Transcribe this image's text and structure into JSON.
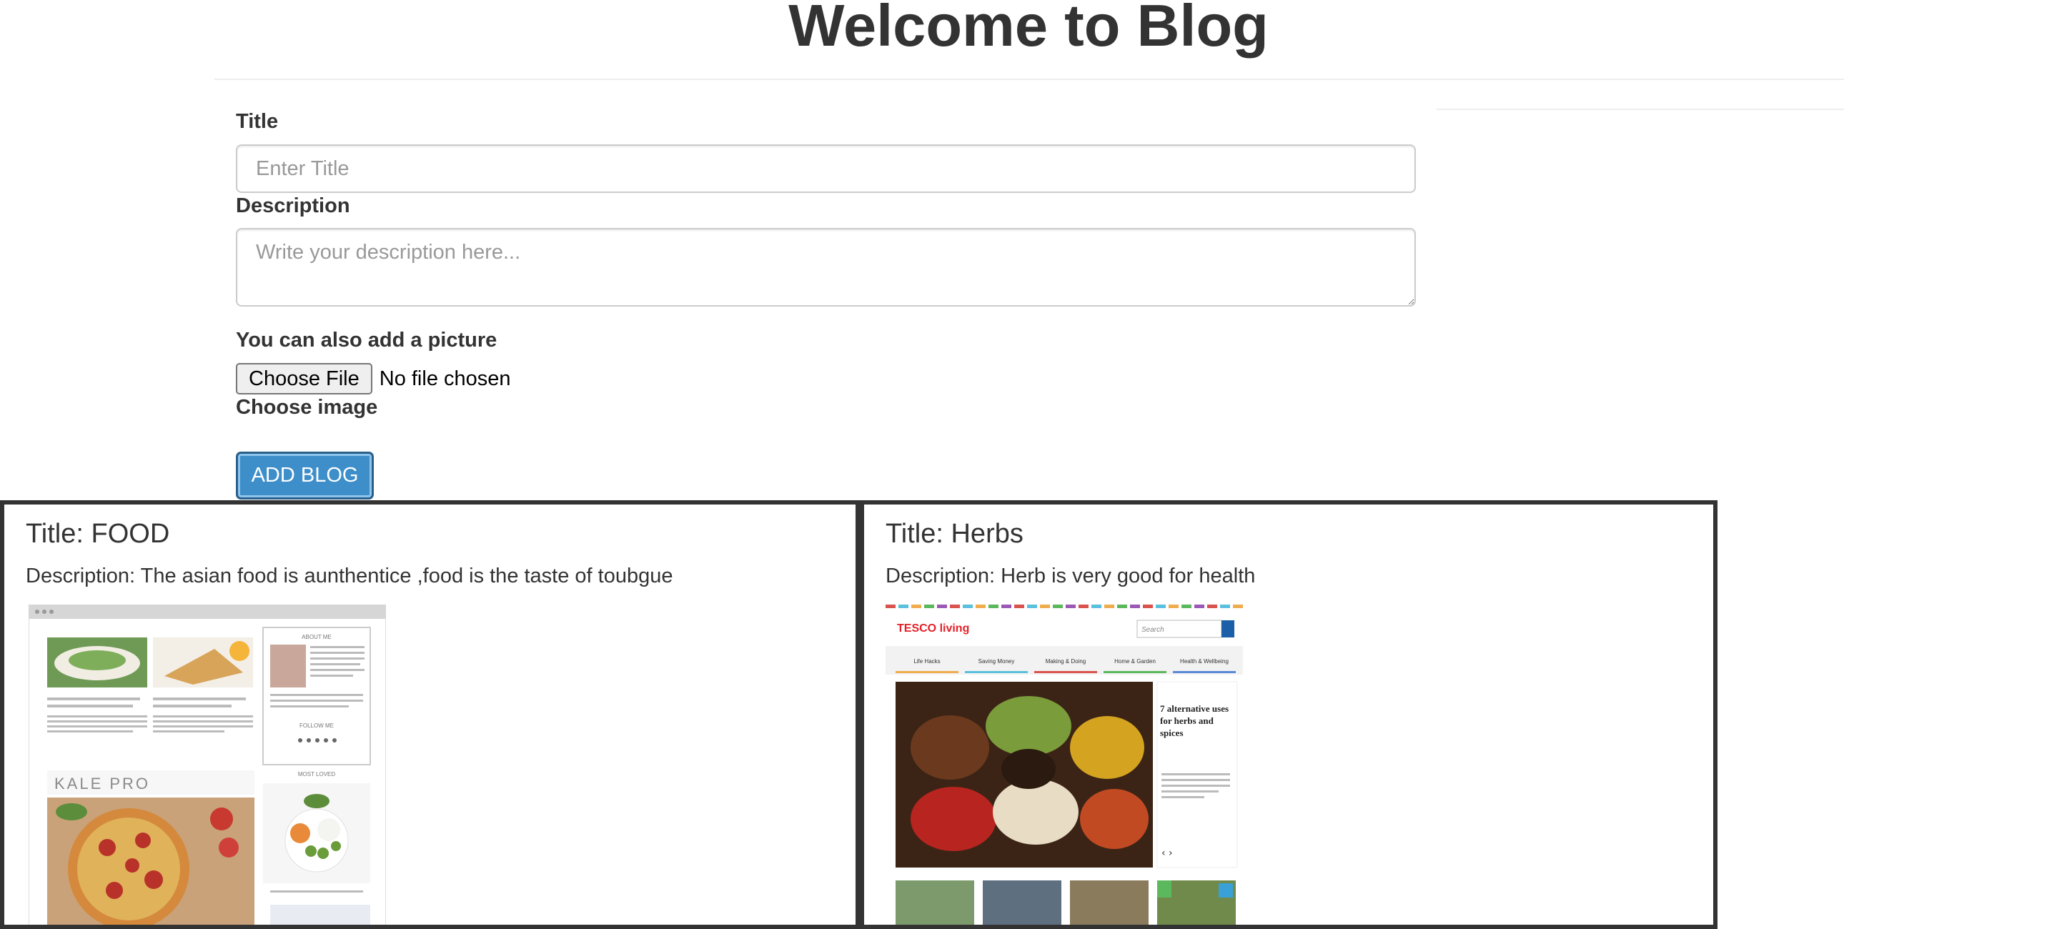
{
  "header": {
    "title": "Welcome to Blog"
  },
  "form": {
    "title_label": "Title",
    "title_placeholder": "Enter Title",
    "description_label": "Description",
    "description_placeholder": "Write your description here...",
    "picture_label": "You can also add a picture",
    "file_button": "Choose File",
    "file_status": "No file chosen",
    "choose_image_label": "Choose image",
    "submit_label": "ADD BLOG"
  },
  "posts": [
    {
      "title": "Title: FOOD",
      "description": "Description: The asian food is aunthentice ,food is the taste of toubgue",
      "thumbnail": {
        "brand": "KALE PRO",
        "sidebar_heading_1": "ABOUT ME",
        "sidebar_heading_2": "FOLLOW ME",
        "sidebar_heading_3": "MOST LOVED"
      }
    },
    {
      "title": "Title: Herbs",
      "description": "Description: Herb is very good for health",
      "thumbnail": {
        "brand": "TESCO living",
        "search_placeholder": "Search",
        "nav": [
          "Life Hacks",
          "Saving Money",
          "Making & Doing",
          "Home & Garden",
          "Health & Wellbeing"
        ],
        "article_title": "7 alternative uses for herbs and spices"
      }
    }
  ]
}
